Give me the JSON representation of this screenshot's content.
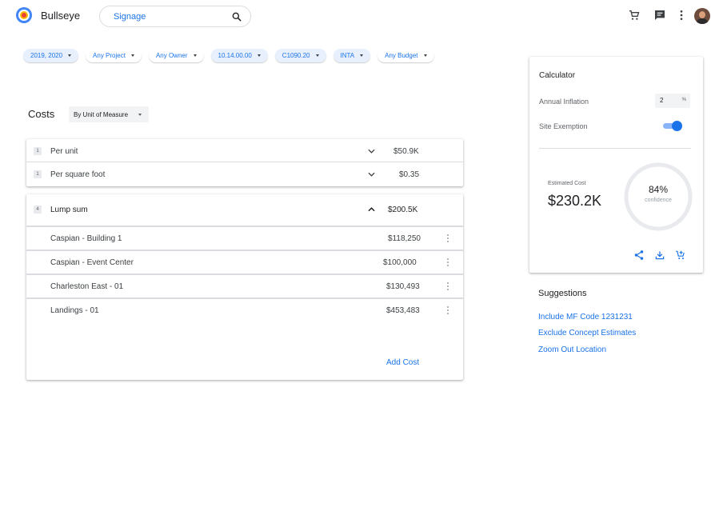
{
  "app": {
    "name": "Bullseye"
  },
  "search": {
    "value": "Signage"
  },
  "header_icons": [
    "cart-icon",
    "chat-icon",
    "more-vert-icon"
  ],
  "filters": [
    {
      "label": "2019, 2020",
      "active": true
    },
    {
      "label": "Any Project",
      "active": false
    },
    {
      "label": "Any Owner",
      "active": false
    },
    {
      "label": "10.14.00.00",
      "active": true
    },
    {
      "label": "C1090.20",
      "active": true
    },
    {
      "label": "INTA",
      "active": true
    },
    {
      "label": "Any Budget",
      "active": false
    }
  ],
  "costs": {
    "title": "Costs",
    "grouping": "By Unit of Measure",
    "rows": [
      {
        "count": "1",
        "label": "Per unit",
        "value": "$50.9K"
      },
      {
        "count": "1",
        "label": "Per square foot",
        "value": "$0.35"
      }
    ],
    "lump": {
      "count": "4",
      "label": "Lump sum",
      "value": "$200.5K",
      "items": [
        {
          "label": "Caspian - Building 1",
          "value": "$118,250"
        },
        {
          "label": "Caspian - Event Center",
          "value": "$100,000"
        },
        {
          "label": "Charleston East - 01",
          "value": "$130,493"
        },
        {
          "label": "Landings - 01",
          "value": "$453,483"
        }
      ]
    },
    "add_label": "Add Cost"
  },
  "calculator": {
    "title": "Calculator",
    "inflation_label": "Annual Inflation",
    "inflation_value": "2",
    "inflation_unit": "%",
    "exemption_label": "Site Exemption",
    "exemption_on": true,
    "estimate_label": "Estimated Cost",
    "estimate_value": "$230.2K",
    "confidence_pct": "84%",
    "confidence_label": "confidence",
    "confidence_fraction": 0.84,
    "actions": [
      "share-icon",
      "download-icon",
      "add-to-cart-icon"
    ]
  },
  "suggestions": {
    "title": "Suggestions",
    "items": [
      "Include MF Code 1231231",
      "Exclude Concept Estimates",
      "Zoom Out Location"
    ]
  },
  "colors": {
    "accent": "#1a73e8",
    "chip_bg": "#e8f0fe",
    "divider": "#dadce0"
  }
}
